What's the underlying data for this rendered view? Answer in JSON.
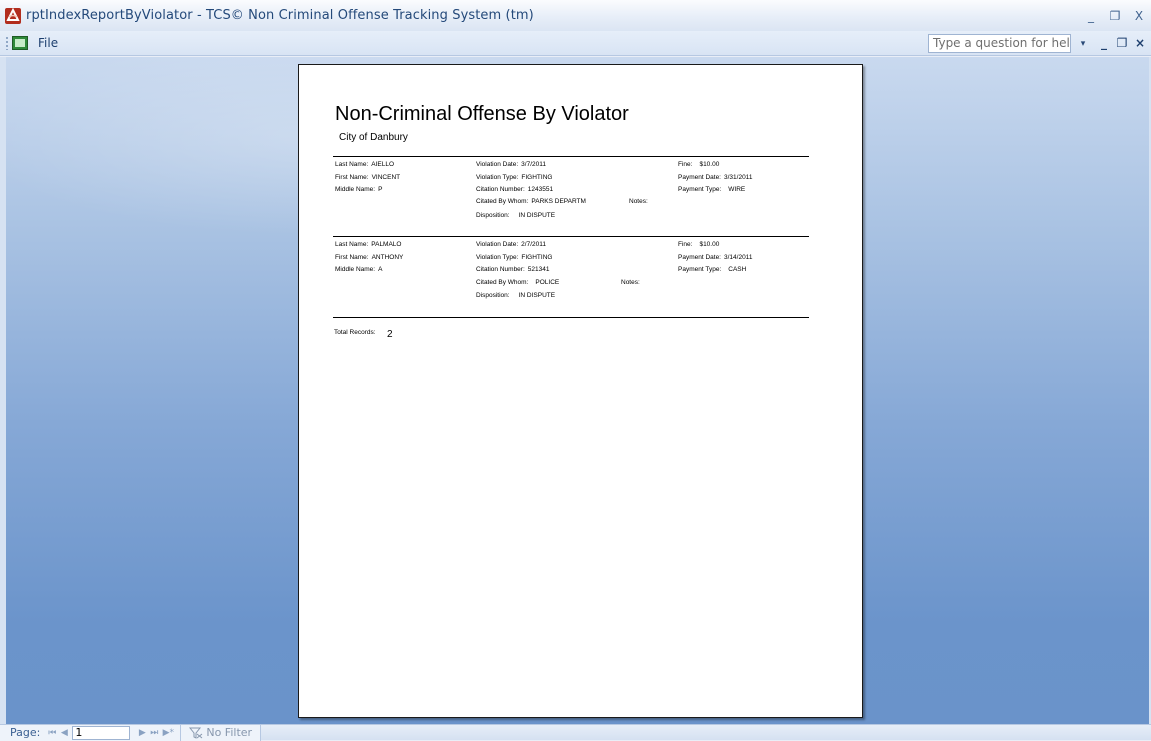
{
  "window": {
    "title": "rptIndexReportByViolator - TCS© Non Criminal Offense Tracking System (tm)",
    "minimize": "_",
    "restore": "❐",
    "close": "X"
  },
  "menubar": {
    "file_label": "File",
    "help_placeholder": "Type a question for help",
    "help_dropdown": "▾",
    "mdi_minimize": "_",
    "mdi_restore": "❐",
    "mdi_close": "×"
  },
  "report": {
    "title": "Non-Criminal Offense By Violator",
    "subtitle": "City of Danbury",
    "records": [
      {
        "last_name_label": "Last Name:",
        "last_name": "AIELLO",
        "first_name_label": "First Name:",
        "first_name": "VINCENT",
        "middle_name_label": "Middle Name:",
        "middle_name": "P",
        "violation_date_label": "Violation Date:",
        "violation_date": "3/7/2011",
        "violation_type_label": "Violation Type:",
        "violation_type": "FIGHTING",
        "citation_number_label": "Citation Number:",
        "citation_number": "1243551",
        "cited_by_label": "Citated By Whom:",
        "cited_by": "PARKS DEPARTM",
        "notes_label": "Notes:",
        "disposition_label": "Disposition:",
        "disposition": "IN DISPUTE",
        "fine_label": "Fine:",
        "fine": "$10.00",
        "payment_date_label": "Payment Date:",
        "payment_date": "3/31/2011",
        "payment_type_label": "Payment Type:",
        "payment_type": "WIRE"
      },
      {
        "last_name_label": "Last Name:",
        "last_name": "PALMALO",
        "first_name_label": "First Name:",
        "first_name": "ANTHONY",
        "middle_name_label": "Middle Name:",
        "middle_name": "A",
        "violation_date_label": "Violation Date:",
        "violation_date": "2/7/2011",
        "violation_type_label": "Violation Type:",
        "violation_type": "FIGHTING",
        "citation_number_label": "Citation Number:",
        "citation_number": "521341",
        "cited_by_label": "Citated By Whom:",
        "cited_by": "POLICE",
        "notes_label": "Notes:",
        "disposition_label": "Disposition:",
        "disposition": "IN DISPUTE",
        "fine_label": "Fine:",
        "fine": "$10.00",
        "payment_date_label": "Payment Date:",
        "payment_date": "3/14/2011",
        "payment_type_label": "Payment Type:",
        "payment_type": "CASH"
      }
    ],
    "total_label": "Total Records:",
    "total_value": "2"
  },
  "statusbar": {
    "page_label": "Page:",
    "first": "⏮",
    "prev": "◀",
    "page_value": "1",
    "next": "▶",
    "last": "⏭",
    "new": "▶*",
    "filter_text": "No Filter"
  },
  "colors": {
    "workspace_top": "#c9d9ef",
    "workspace_bottom": "#6a93ca",
    "title_text": "#24497a"
  }
}
